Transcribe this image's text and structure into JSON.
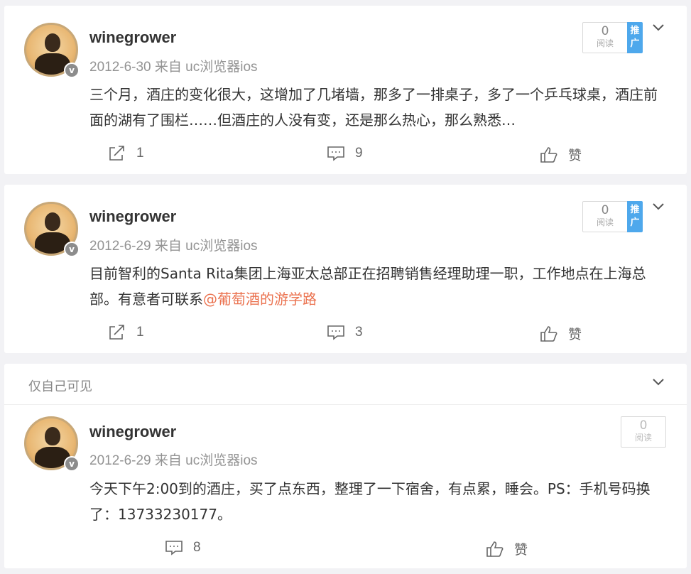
{
  "posts": [
    {
      "username": "winegrower",
      "meta": "2012-6-30 来自 uc浏览器ios",
      "text": "三个月，酒庄的变化很大，这增加了几堵墙，那多了一排桌子，多了一个乒乓球桌，酒庄前面的湖有了围栏……但酒庄的人没有变，还是那么热心，那么熟悉…",
      "read_count": "0",
      "read_label": "阅读",
      "promo_label": "推广",
      "share_count": "1",
      "comment_count": "9",
      "like_label": "赞"
    },
    {
      "username": "winegrower",
      "meta": "2012-6-29 来自 uc浏览器ios",
      "text": "目前智利的Santa Rita集团上海亚太总部正在招聘销售经理助理一职，工作地点在上海总部。有意者可联系",
      "mention": "@葡萄酒的游学路",
      "read_count": "0",
      "read_label": "阅读",
      "promo_label": "推广",
      "share_count": "1",
      "comment_count": "3",
      "like_label": "赞"
    },
    {
      "visibility": "仅自己可见",
      "username": "winegrower",
      "meta": "2012-6-29 来自 uc浏览器ios",
      "text": "今天下午2:00到的酒庄，买了点东西，整理了一下宿舍，有点累，睡会。PS：手机号码换了：13733230177。",
      "read_count": "0",
      "read_label": "阅读",
      "comment_count": "8",
      "like_label": "赞"
    }
  ],
  "icons": {
    "verified": "v-badge-icon",
    "share": "share-icon",
    "comment": "comment-icon",
    "like": "thumbs-up-icon",
    "expand": "chevron-down-icon"
  },
  "colors": {
    "background": "#f2f2f5",
    "mention": "#eb7350",
    "promo": "#4ea8ec",
    "meta": "#939393"
  }
}
